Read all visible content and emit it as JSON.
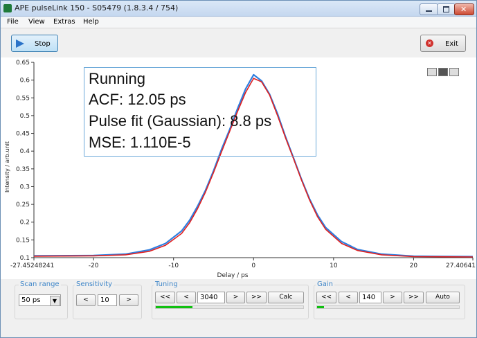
{
  "window": {
    "title": "APE pulseLink 150 - S05479 (1.8.3.4 / 754)",
    "minimize_glyph": "—",
    "maximize_glyph": "□",
    "close_glyph": "✕"
  },
  "menu": [
    "File",
    "View",
    "Extras",
    "Help"
  ],
  "toolbar": {
    "stop_label": "Stop",
    "stop_icon": "play-triangle-icon",
    "exit_label": "Exit",
    "exit_icon": "close-circle-icon"
  },
  "info": {
    "status": "Running",
    "acf": "ACF: 12.05 ps",
    "pulse_fit": "Pulse fit (Gaussian): 8.8 ps",
    "mse": "MSE: 1.110E-5"
  },
  "chart_tools": [
    "crosshair-icon",
    "zoom-icon",
    "pan-hand-icon"
  ],
  "controls": {
    "scan_range": {
      "label": "Scan range",
      "value": "50 ps",
      "arrow": "▼"
    },
    "sensitivity": {
      "label": "Sensitivity",
      "dec": "<",
      "value": "10",
      "inc": ">"
    },
    "tuning": {
      "label": "Tuning",
      "fast_dec": "<<",
      "dec": "<",
      "value": "3040",
      "inc": ">",
      "fast_inc": ">>",
      "calc": "Calc",
      "progress": 0.25
    },
    "gain": {
      "label": "Gain",
      "fast_dec": "<<",
      "dec": "<",
      "value": "140",
      "inc": ">",
      "fast_inc": ">>",
      "auto": "Auto",
      "progress": 0.05
    }
  },
  "chart_data": {
    "type": "line",
    "xlabel": "Delay / ps",
    "ylabel": "Intensity / arb.unit",
    "xlim": [
      -27.45248241,
      27.40641
    ],
    "ylim": [
      0.1,
      0.65
    ],
    "x_tick_labels": [
      "-27.45248241",
      "-20",
      "-10",
      "0",
      "10",
      "20",
      "27.40641"
    ],
    "x_ticks": [
      -27.45248241,
      -20,
      -10,
      0,
      10,
      20,
      27.40641
    ],
    "y_tick_labels": [
      "0.1",
      "0.15",
      "0.2",
      "0.25",
      "0.3",
      "0.35",
      "0.4",
      "0.45",
      "0.5",
      "0.55",
      "0.6",
      "0.65"
    ],
    "y_ticks": [
      0.1,
      0.15,
      0.2,
      0.25,
      0.3,
      0.35,
      0.4,
      0.45,
      0.5,
      0.55,
      0.6,
      0.65
    ],
    "grid": false,
    "series": [
      {
        "color": "#2f7fe0",
        "x": [
          -27.45,
          -20,
          -16,
          -13,
          -11,
          -9,
          -8,
          -7,
          -6,
          -5,
          -4,
          -3,
          -2,
          -1,
          0,
          1,
          2,
          3,
          4,
          5,
          6,
          7,
          8,
          9,
          11,
          13,
          16,
          20,
          27.4
        ],
        "y": [
          0.105,
          0.106,
          0.11,
          0.122,
          0.14,
          0.175,
          0.205,
          0.245,
          0.29,
          0.345,
          0.405,
          0.46,
          0.52,
          0.575,
          0.615,
          0.598,
          0.56,
          0.505,
          0.44,
          0.38,
          0.32,
          0.265,
          0.22,
          0.185,
          0.145,
          0.123,
          0.11,
          0.104,
          0.103
        ]
      },
      {
        "color": "#e02020",
        "x": [
          -27.45,
          -20,
          -16,
          -13,
          -11,
          -9,
          -8,
          -7,
          -6,
          -5,
          -4,
          -3,
          -2,
          -1,
          0,
          1,
          2,
          3,
          4,
          5,
          6,
          7,
          8,
          9,
          11,
          13,
          16,
          20,
          27.4
        ],
        "y": [
          0.104,
          0.105,
          0.108,
          0.118,
          0.135,
          0.168,
          0.198,
          0.238,
          0.285,
          0.34,
          0.398,
          0.455,
          0.512,
          0.565,
          0.605,
          0.595,
          0.558,
          0.5,
          0.437,
          0.378,
          0.318,
          0.262,
          0.215,
          0.18,
          0.14,
          0.12,
          0.108,
          0.103,
          0.102
        ]
      }
    ]
  }
}
